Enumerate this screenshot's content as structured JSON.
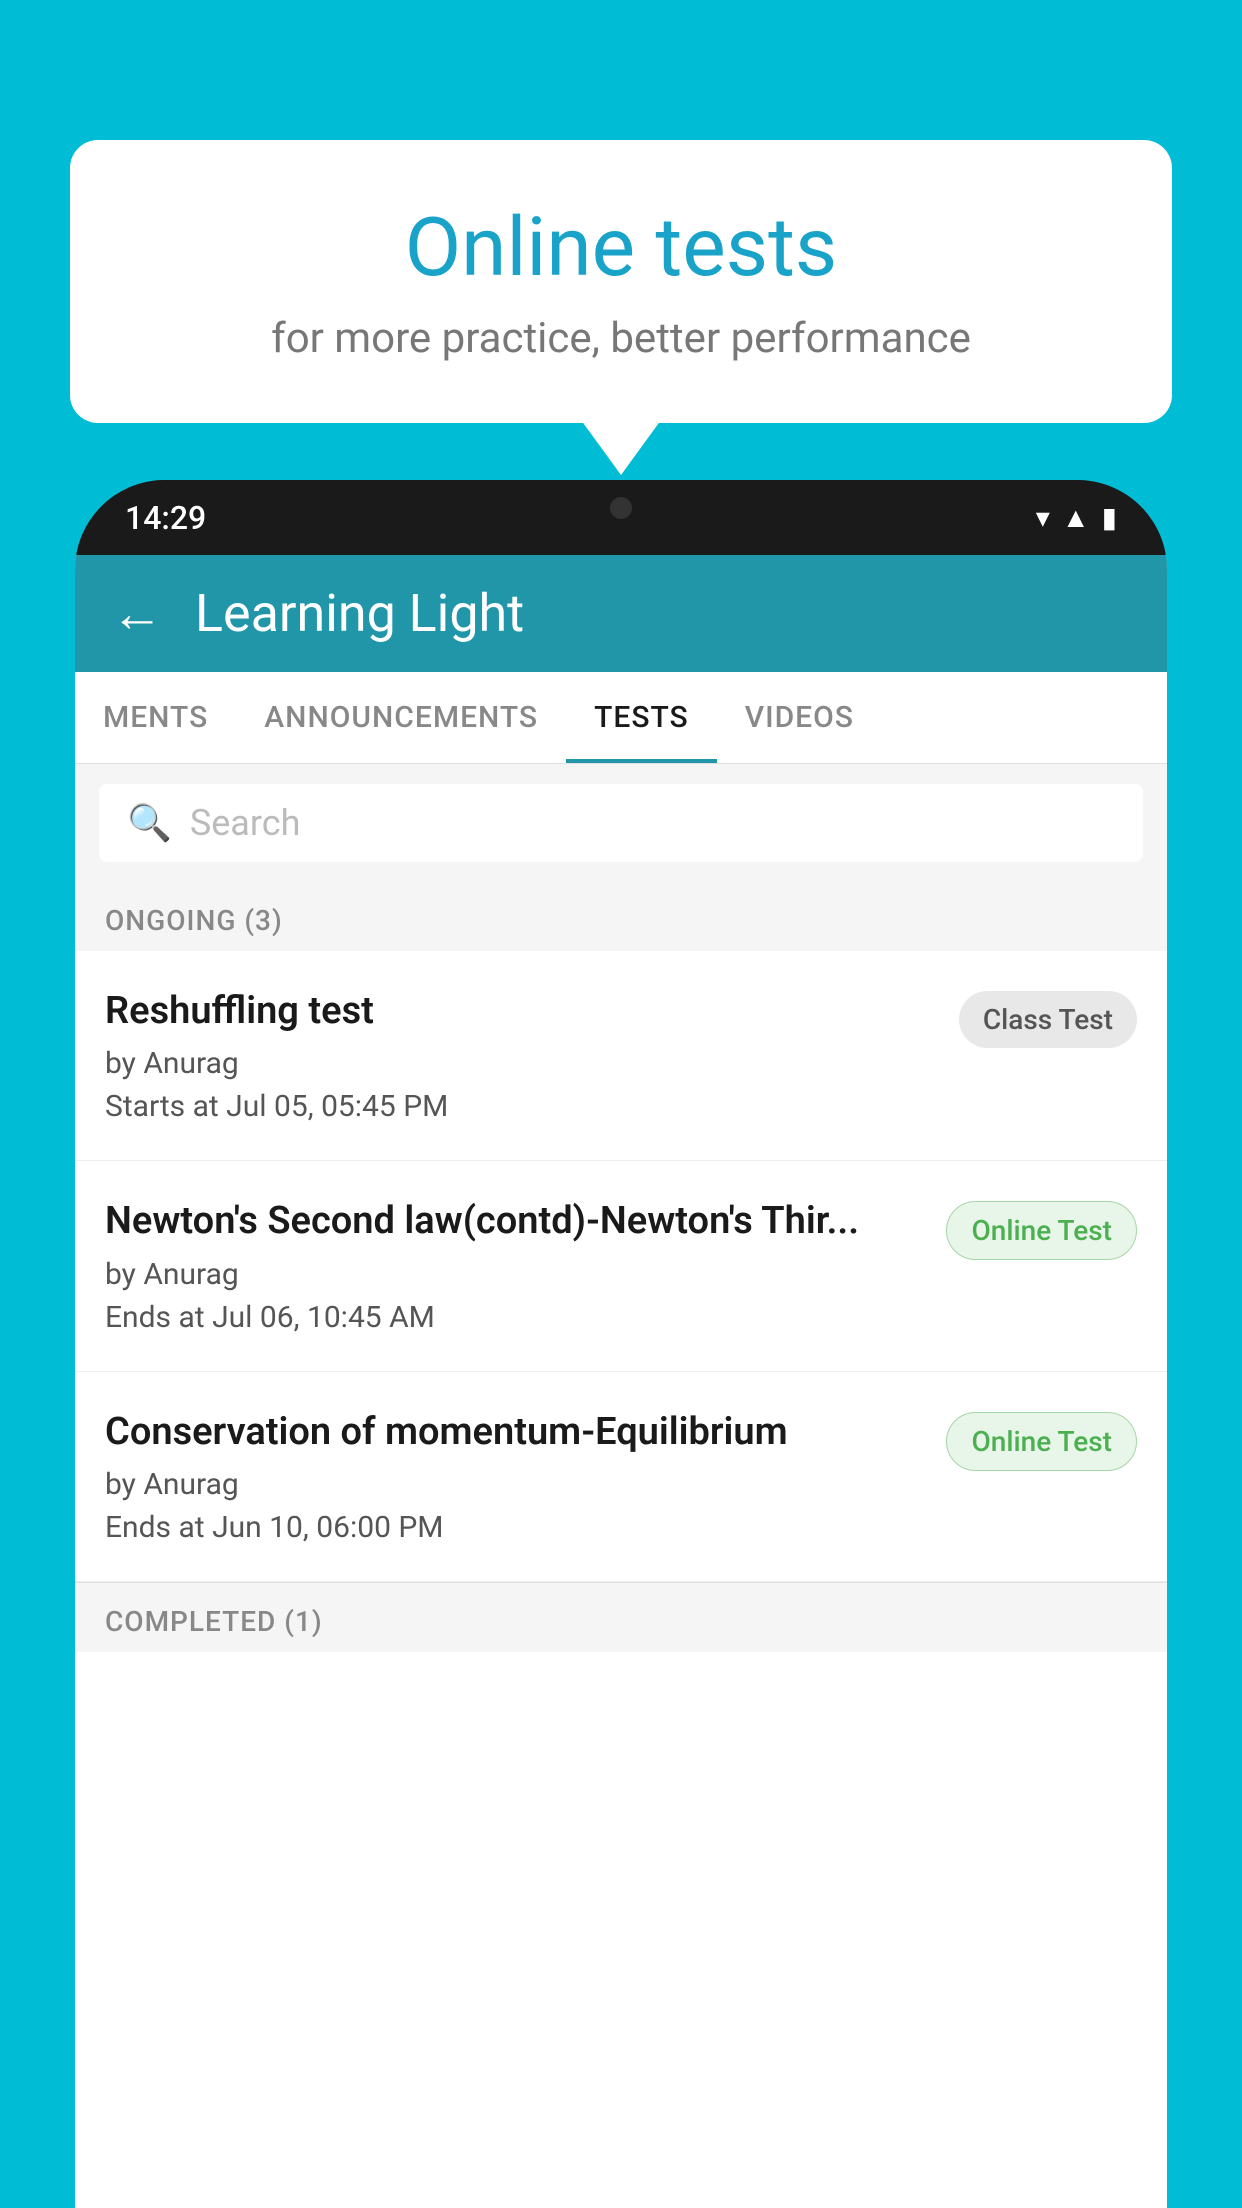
{
  "background_color": "#00bcd4",
  "speech_bubble": {
    "title": "Online tests",
    "subtitle": "for more practice, better performance"
  },
  "phone": {
    "status_bar": {
      "time": "14:29",
      "icons": [
        "wifi",
        "signal",
        "battery"
      ]
    },
    "header": {
      "title": "Learning Light",
      "back_label": "←"
    },
    "tabs": [
      {
        "label": "MENTS",
        "active": false
      },
      {
        "label": "ANNOUNCEMENTS",
        "active": false
      },
      {
        "label": "TESTS",
        "active": true
      },
      {
        "label": "VIDEOS",
        "active": false
      }
    ],
    "search": {
      "placeholder": "Search"
    },
    "ongoing_section": {
      "label": "ONGOING (3)",
      "tests": [
        {
          "name": "Reshuffling test",
          "by": "by Anurag",
          "time_label": "Starts at",
          "time": "Jul 05, 05:45 PM",
          "badge": "Class Test",
          "badge_type": "class"
        },
        {
          "name": "Newton's Second law(contd)-Newton's Thir...",
          "by": "by Anurag",
          "time_label": "Ends at",
          "time": "Jul 06, 10:45 AM",
          "badge": "Online Test",
          "badge_type": "online"
        },
        {
          "name": "Conservation of momentum-Equilibrium",
          "by": "by Anurag",
          "time_label": "Ends at",
          "time": "Jun 10, 06:00 PM",
          "badge": "Online Test",
          "badge_type": "online"
        }
      ]
    },
    "completed_section": {
      "label": "COMPLETED (1)"
    }
  }
}
